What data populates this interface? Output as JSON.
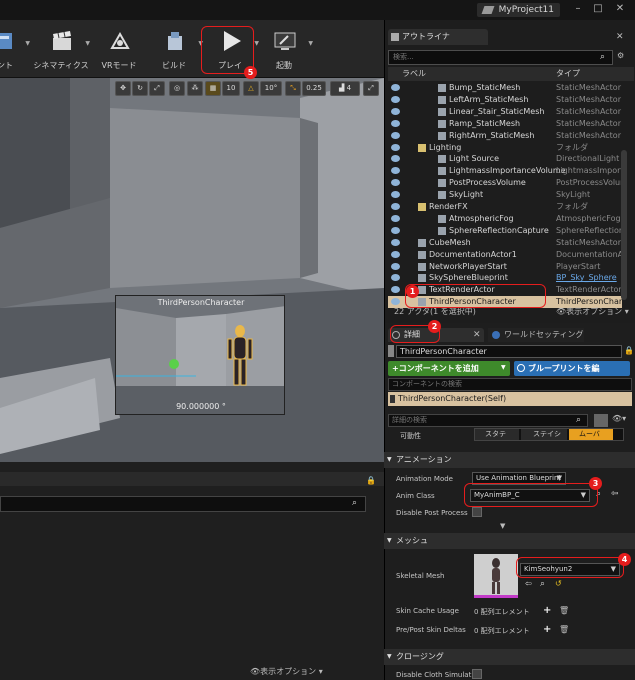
{
  "title_bar": {
    "project_name": "MyProject11"
  },
  "toolbar": {
    "items": [
      {
        "label": "リント",
        "icon": "blueprint-icon"
      },
      {
        "label": "シネマティクス",
        "icon": "clapper-icon"
      },
      {
        "label": "VRモード",
        "icon": "vr-icon"
      },
      {
        "label": "ビルド",
        "icon": "build-icon"
      },
      {
        "label": "プレイ",
        "icon": "play-icon"
      },
      {
        "label": "起動",
        "icon": "launch-icon"
      }
    ]
  },
  "viewport": {
    "toolbar": {
      "grid": "10",
      "rotation": "10°",
      "scale": "0.25",
      "camera_speed": "4"
    },
    "preview": {
      "caption": "ThirdPersonCharacter",
      "angle": "90.000000 °"
    }
  },
  "outliner": {
    "tab_label": "アウトライナ",
    "search_placeholder": "検索...",
    "col_label": "ラベル",
    "col_type": "タイプ",
    "rows": [
      {
        "name": "Bump_StaticMesh",
        "type": "StaticMeshActor",
        "indent": 2
      },
      {
        "name": "LeftArm_StaticMesh",
        "type": "StaticMeshActor",
        "indent": 2
      },
      {
        "name": "Linear_Stair_StaticMesh",
        "type": "StaticMeshActor",
        "indent": 2
      },
      {
        "name": "Ramp_StaticMesh",
        "type": "StaticMeshActor",
        "indent": 2
      },
      {
        "name": "RightArm_StaticMesh",
        "type": "StaticMeshActor",
        "indent": 2
      },
      {
        "name": "Lighting",
        "type": "フォルダ",
        "indent": 1
      },
      {
        "name": "Light Source",
        "type": "DirectionalLight",
        "indent": 2
      },
      {
        "name": "LightmassImportanceVolume",
        "type": "LightmassImporta",
        "indent": 2
      },
      {
        "name": "PostProcessVolume",
        "type": "PostProcessVolum",
        "indent": 2
      },
      {
        "name": "SkyLight",
        "type": "SkyLight",
        "indent": 2
      },
      {
        "name": "RenderFX",
        "type": "フォルダ",
        "indent": 1
      },
      {
        "name": "AtmosphericFog",
        "type": "AtmosphericFog",
        "indent": 2
      },
      {
        "name": "SphereReflectionCapture",
        "type": "SphereReflectionC",
        "indent": 2
      },
      {
        "name": "CubeMesh",
        "type": "StaticMeshActor",
        "indent": 1
      },
      {
        "name": "DocumentationActor1",
        "type": "DocumentationAct",
        "indent": 1
      },
      {
        "name": "NetworkPlayerStart",
        "type": "PlayerStart",
        "indent": 1
      },
      {
        "name": "SkySphereBlueprint",
        "type": "BP_Sky_Sphere",
        "indent": 1
      },
      {
        "name": "TextRenderActor",
        "type": "TextRenderActor",
        "indent": 1
      },
      {
        "name": "ThirdPersonCharacter",
        "type": "ThirdPersonChara",
        "indent": 1
      }
    ],
    "footer": "22 アクタ(1 を選択中)",
    "view_options": "表示オプション"
  },
  "details": {
    "tab_details": "詳細",
    "tab_world": "ワールドセッティング",
    "actor_name": "ThirdPersonCharacter",
    "add_component": "+コンポーネントを追加",
    "blueprint_btn": "ブループリントを編",
    "component_search": "コンポーネントの検索",
    "self_item": "ThirdPersonCharacter(Self)",
    "detail_search": "詳細の検索",
    "mobility_label": "可動性",
    "mobility_options": [
      "スタテ",
      "ステイシ",
      "ムーバ"
    ],
    "sections": {
      "animation": "アニメーション",
      "mesh": "メッシュ",
      "clothing": "クロージング"
    },
    "props": {
      "anim_mode_label": "Animation Mode",
      "anim_mode_value": "Use Animation Blueprint",
      "anim_class_label": "Anim Class",
      "anim_class_value": "MyAnimBP_C",
      "disable_post_label": "Disable Post Process",
      "skeletal_mesh_label": "Skeletal Mesh",
      "skeletal_mesh_value": "KimSeohyun2",
      "skin_cache_label": "Skin Cache Usage",
      "skin_cache_value": "0 配列エレメント",
      "pre_post_label": "Pre/Post Skin Deltas",
      "pre_post_value": "0 配列エレメント",
      "disable_cloth_label": "Disable Cloth Simulati"
    }
  },
  "content_browser": {
    "view_options": "表示オプション"
  },
  "annotations": [
    "1",
    "2",
    "3",
    "4",
    "5"
  ],
  "colors": {
    "annotation": "#e51d1d",
    "selection": "#d8c2a0",
    "add_btn": "#3e8a2b",
    "blueprint_btn": "#2a6fb4"
  }
}
